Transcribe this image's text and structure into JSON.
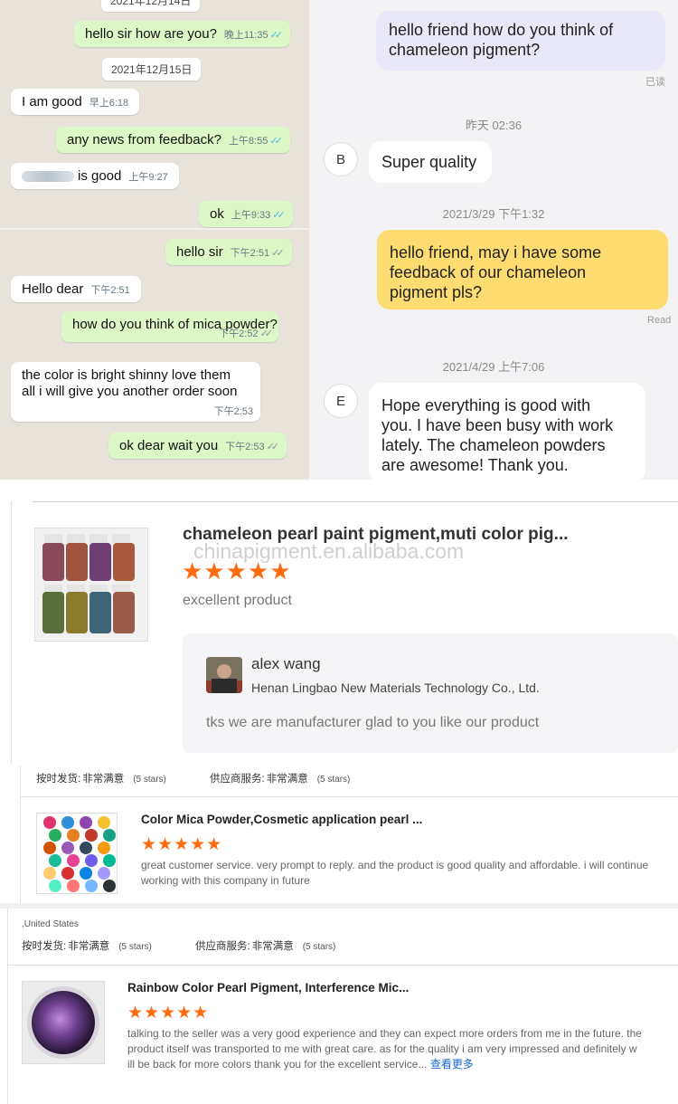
{
  "whatsapp": {
    "top_partial_date": "2021年12月14日",
    "messages": [
      {
        "dir": "out",
        "text": "hello sir how are you?",
        "time": "晚上11:35",
        "tick": "blue"
      },
      {
        "dir": "date",
        "text": "2021年12月15日"
      },
      {
        "dir": "in",
        "text": "I am good",
        "time": "早上6:18"
      },
      {
        "dir": "out",
        "text": "any news from feedback?",
        "time": "上午8:55",
        "tick": "blue"
      },
      {
        "dir": "in",
        "text": "is good",
        "time": "上午9:27"
      },
      {
        "dir": "out",
        "text": "ok",
        "time": "上午9:33",
        "tick": "blue"
      },
      {
        "dir": "out",
        "text": "hello sir",
        "time": "下午2:51",
        "tick": "grey"
      },
      {
        "dir": "in",
        "text": "Hello dear",
        "time": "下午2:51"
      },
      {
        "dir": "out",
        "text": "how do you think of mica powder?",
        "time": "下午2:52",
        "tick": "grey"
      },
      {
        "dir": "in",
        "text_line1": "the color is bright shinny love them",
        "text_line2": "all i will give you another order soon",
        "time": "下午2:53"
      },
      {
        "dir": "out",
        "text": "ok dear wait you",
        "time": "下午2:53",
        "tick": "grey"
      }
    ]
  },
  "chat": {
    "msg1": {
      "line1": "hello friend how do you think of",
      "line2": "chameleon pigment?",
      "status": "已读"
    },
    "ts1": "昨天 02:36",
    "reply1": {
      "avatar": "B",
      "text": "Super quality"
    },
    "ts2": "2021/3/29 下午1:32",
    "msg2": {
      "line1": "hello friend, may i have some",
      "line2": "feedback of our chameleon",
      "line3": "pigment pls?",
      "status": "Read"
    },
    "ts3": "2021/4/29 上午7:06",
    "reply2": {
      "avatar": "E",
      "line1": "Hope everything is good with",
      "line2": "you. I have been busy with work",
      "line3": "lately. The chameleon powders",
      "line4": "are awesome! Thank you."
    }
  },
  "review1": {
    "title": "chameleon pearl paint pigment,muti color pig...",
    "stars": "★★★★★",
    "rating": 5,
    "text": "excellent product",
    "watermark": "chinapigment.en.alibaba.com",
    "reply": {
      "name": "alex wang",
      "company": "Henan Lingbao New Materials Technology Co., Ltd.",
      "text": "tks we are manufacturer  glad to you like our product"
    }
  },
  "meta1": {
    "ship_label": "按时发货:",
    "ship_val": "非常满意",
    "ship_stars": "(5 stars)",
    "svc_label": "供应商服务:",
    "svc_val": "非常满意",
    "svc_stars": "(5 stars)"
  },
  "review2": {
    "title": "Color Mica Powder,Cosmetic application pearl ...",
    "stars": "★★★★★",
    "rating": 5,
    "line1": "great customer service. very prompt to reply. and the product is good quality and affordable. i will continue",
    "line2": "working with this company in future"
  },
  "meta2": {
    "country": ",United States",
    "ship_label": "按时发货:",
    "ship_val": "非常满意",
    "ship_stars": "(5 stars)",
    "svc_label": "供应商服务:",
    "svc_val": "非常满意",
    "svc_stars": "(5 stars)"
  },
  "review3": {
    "title": "Rainbow Color Pearl Pigment, Interference Mic...",
    "stars": "★★★★★",
    "rating": 5,
    "line1": "talking to the seller was a very good experience and they can expect more orders from me in the future. the",
    "line2": "product itself was transported to me with great care. as for the quality i am very impressed and definitely w",
    "line3": "ill be back for more colors thank you for the excellent service...",
    "more": "查看更多"
  },
  "colors": {
    "wa_bg": "#e7e2da",
    "wa_out": "#dcf8c6",
    "chat_yellow": "#ffdc72",
    "chat_lavender": "#e8e8f8",
    "star": "#ff6b0f",
    "link": "#1a66d2"
  }
}
